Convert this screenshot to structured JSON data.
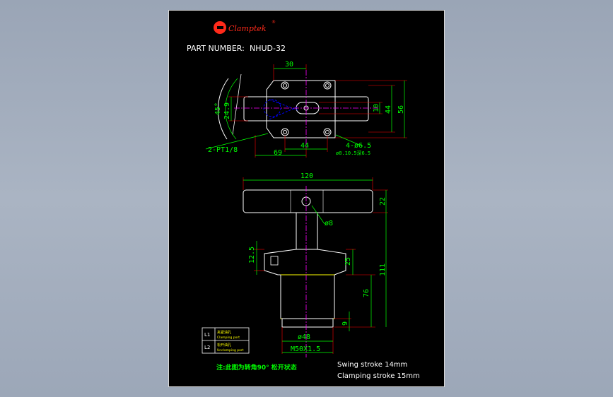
{
  "brand": {
    "logo_letter": "G",
    "name": "Clamptek",
    "reg_mark": "®"
  },
  "title": {
    "part_label": "PART NUMBER:",
    "part_number": "NHUD-32"
  },
  "top_view": {
    "dims": [
      "30",
      "24.9",
      "45°",
      "10",
      "44",
      "56",
      "2-PT1/8",
      "44",
      "69",
      "4-ø6.5",
      "ø8.10.5深6.5"
    ]
  },
  "side_view": {
    "dims": [
      "120",
      "22",
      "ø8",
      "12.5",
      "25",
      "111",
      "76",
      "9",
      "ø48",
      "M50X1.5"
    ]
  },
  "legend": {
    "rows": [
      {
        "id": "L1",
        "text_cn": "夹紧油孔",
        "text_en": "Clamping port"
      },
      {
        "id": "L2",
        "text_cn": "松开油孔",
        "text_en": "Unclamping port"
      }
    ]
  },
  "note_cn": "注:此图为转角90° 松开状态",
  "specs": {
    "swing": "Swing stroke 14mm",
    "clamp": "Clamping stroke 15mm"
  },
  "colors": {
    "background": "#000000",
    "outline": "#ffffff",
    "dimension": "#00ff00",
    "extension": "#ff0000",
    "centerline": "#ff00ff",
    "hidden": "#0000ff",
    "thread": "#ffff00",
    "logo": "#ff2a1a"
  }
}
